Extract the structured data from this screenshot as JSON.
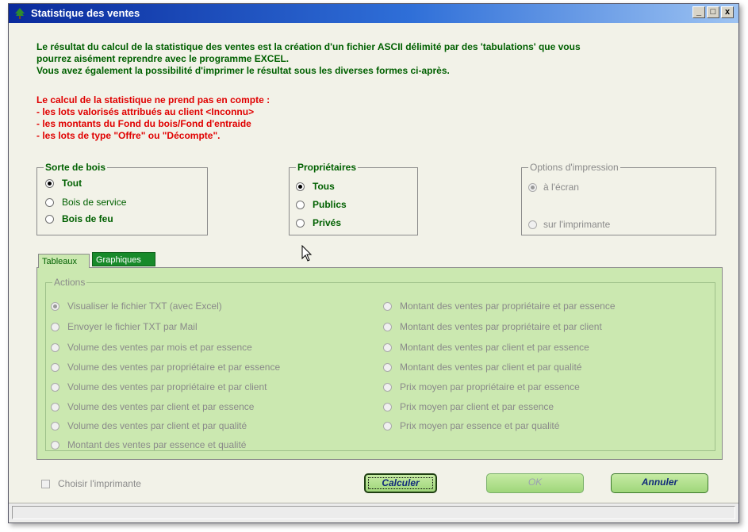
{
  "window": {
    "title": "Statistique des ventes",
    "controls": {
      "minimize": "_",
      "restore": "□",
      "close": "x"
    }
  },
  "info_green": [
    "Le résultat du calcul de la statistique des ventes est la création d'un fichier ASCII délimité par des 'tabulations' que vous",
    "pourrez aisément reprendre avec le programme EXCEL.",
    "Vous avez également la possibilité d'imprimer le résultat sous les diverses formes ci-après."
  ],
  "info_red": [
    "Le calcul de la statistique ne prend pas en compte :",
    "- les lots valorisés attribués au client <Inconnu>",
    "- les montants du Fond du bois/Fond d'entraide",
    "- les lots de type \"Offre\" ou \"Décompte\"."
  ],
  "sorte_bois": {
    "legend": "Sorte de bois",
    "options": [
      {
        "label": "Tout",
        "selected": true
      },
      {
        "label": "Bois de service",
        "selected": false
      },
      {
        "label": "Bois de feu",
        "selected": false
      }
    ]
  },
  "proprietaires": {
    "legend": "Propriétaires",
    "options": [
      {
        "label": "Tous",
        "selected": true
      },
      {
        "label": "Publics",
        "selected": false
      },
      {
        "label": "Privés",
        "selected": false
      }
    ]
  },
  "options_impression": {
    "legend": "Options d'impression",
    "options": [
      {
        "label": "à l'écran",
        "selected": true
      },
      {
        "label": "sur l'imprimante",
        "selected": false
      }
    ]
  },
  "tabs": {
    "tableaux": "Tableaux",
    "graphiques": "Graphiques"
  },
  "actions": {
    "legend": "Actions",
    "left": [
      {
        "label": "Visualiser le fichier TXT (avec Excel)",
        "selected": true
      },
      {
        "label": "Envoyer le fichier TXT par Mail",
        "selected": false
      },
      {
        "label": "Volume des ventes par mois et par essence",
        "selected": false
      },
      {
        "label": "Volume des ventes par propriétaire et par essence",
        "selected": false
      },
      {
        "label": "Volume des ventes par propriétaire et par client",
        "selected": false
      },
      {
        "label": "Volume des ventes par client et par essence",
        "selected": false
      },
      {
        "label": "Volume des ventes par client et par qualité",
        "selected": false
      },
      {
        "label": "Montant des ventes par essence et qualité",
        "selected": false
      }
    ],
    "right": [
      {
        "label": "Montant des ventes par propriétaire et par essence",
        "selected": false
      },
      {
        "label": "Montant des ventes par propriétaire et par client",
        "selected": false
      },
      {
        "label": "Montant des ventes par client et par essence",
        "selected": false
      },
      {
        "label": "Montant des ventes par client et par qualité",
        "selected": false
      },
      {
        "label": "Prix moyen par propriétaire et par essence",
        "selected": false
      },
      {
        "label": "Prix moyen par client et par essence",
        "selected": false
      },
      {
        "label": "Prix moyen par essence et par qualité",
        "selected": false
      }
    ]
  },
  "choisir_imprimante": {
    "label": "Choisir l'imprimante",
    "checked": false
  },
  "buttons": {
    "calculer": "Calculer",
    "ok": "OK",
    "annuler": "Annuler"
  },
  "status": {
    "text": ""
  },
  "colors": {
    "accent_green": "#006000",
    "warning_red": "#e00000",
    "panel_green": "#cbe8b0",
    "title_blue": "#0a2a9c"
  }
}
